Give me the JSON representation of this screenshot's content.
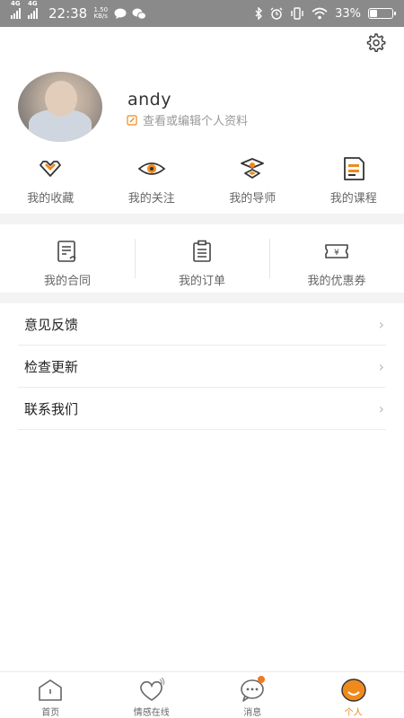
{
  "status_bar": {
    "network1": "4G",
    "network2": "4G",
    "time": "22:38",
    "speed_value": "1.50",
    "speed_unit": "KB/s",
    "battery_percent": "33%",
    "battery_level": 0.33
  },
  "profile": {
    "name": "andy",
    "edit_hint": "查看或编辑个人资料"
  },
  "quick_actions": [
    {
      "label": "我的收藏",
      "icon": "heart-box-icon"
    },
    {
      "label": "我的关注",
      "icon": "eye-icon"
    },
    {
      "label": "我的导师",
      "icon": "mentor-icon"
    },
    {
      "label": "我的课程",
      "icon": "course-icon"
    }
  ],
  "secondary_actions": [
    {
      "label": "我的合同",
      "icon": "contract-icon"
    },
    {
      "label": "我的订单",
      "icon": "order-icon"
    },
    {
      "label": "我的优惠券",
      "icon": "coupon-icon",
      "coupon_symbol": "¥"
    }
  ],
  "menu": [
    {
      "label": "意见反馈"
    },
    {
      "label": "检查更新"
    },
    {
      "label": "联系我们"
    }
  ],
  "tabs": [
    {
      "label": "首页",
      "icon": "home-icon"
    },
    {
      "label": "情感在线",
      "icon": "heart-online-icon"
    },
    {
      "label": "消息",
      "icon": "message-icon",
      "has_badge": true
    },
    {
      "label": "个人",
      "icon": "profile-smile-icon",
      "active": true
    }
  ],
  "colors": {
    "accent": "#f08a1c",
    "status_bar": "#8a8a8a",
    "icon_dark": "#333333"
  }
}
